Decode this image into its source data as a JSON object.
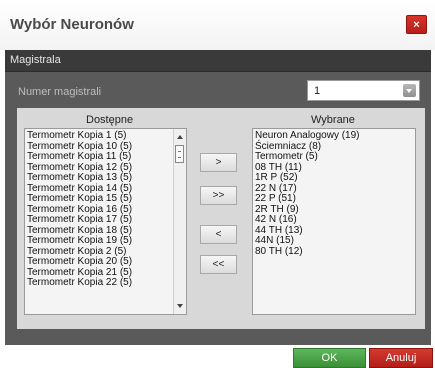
{
  "dialog": {
    "title": "Wybór Neuronów",
    "close_glyph": "×"
  },
  "section": {
    "title": "Magistrala"
  },
  "bus_number": {
    "label": "Numer magistrali",
    "selected": "1"
  },
  "available": {
    "title": "Dostępne",
    "items": [
      "Termometr Kopia  1 (5)",
      "Termometr Kopia  10 (5)",
      "Termometr Kopia  11 (5)",
      "Termometr Kopia  12 (5)",
      "Termometr Kopia  13 (5)",
      "Termometr Kopia  14 (5)",
      "Termometr Kopia  15 (5)",
      "Termometr Kopia  16 (5)",
      "Termometr Kopia  17 (5)",
      "Termometr Kopia  18 (5)",
      "Termometr Kopia  19 (5)",
      "Termometr Kopia  2 (5)",
      "Termometr Kopia  20 (5)",
      "Termometr Kopia  21 (5)",
      "Termometr Kopia  22 (5)"
    ]
  },
  "selected": {
    "title": "Wybrane",
    "items": [
      "Neuron Analogowy (19)",
      "Ściemniacz (8)",
      "Termometr (5)",
      "08 TH (11)",
      "1R P (52)",
      "22 N (17)",
      "22 P (51)",
      "2R TH (9)",
      "42 N (16)",
      "44 TH (13)",
      "44N (15)",
      "80 TH (12)"
    ]
  },
  "transfer": {
    "add": ">",
    "add_all": ">>",
    "remove": "<",
    "remove_all": "<<"
  },
  "footer": {
    "ok": "OK",
    "cancel": "Anuluj"
  },
  "colors": {
    "ok": "#4aa546",
    "cancel": "#c42a22",
    "close": "#c8291f"
  }
}
